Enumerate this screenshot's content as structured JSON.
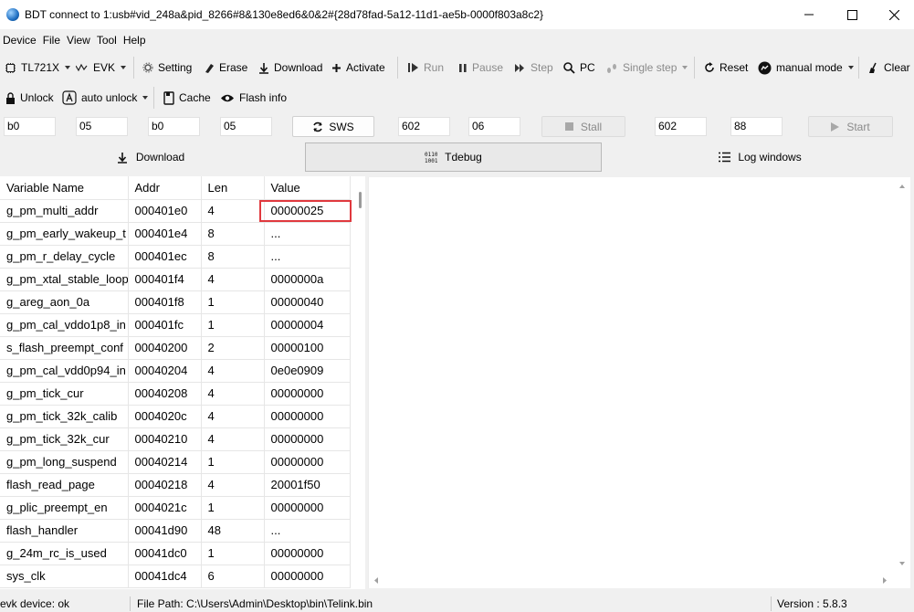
{
  "window": {
    "title": "BDT connect to 1:usb#vid_248a&pid_8266#8&130e8ed6&0&2#{28d78fad-5a12-11d1-ae5b-0000f803a8c2}"
  },
  "menu": [
    "Device",
    "File",
    "View",
    "Tool",
    "Help"
  ],
  "toolbar1": {
    "chip": "TL721X",
    "board": "EVK",
    "setting": "Setting",
    "erase": "Erase",
    "download": "Download",
    "activate": "Activate",
    "run": "Run",
    "pause": "Pause",
    "step": "Step",
    "pc": "PC",
    "single_step": "Single step",
    "reset": "Reset",
    "mode": "manual mode",
    "clear": "Clear"
  },
  "toolbar2": {
    "unlock": "Unlock",
    "auto_unlock": "auto unlock",
    "cache": "Cache",
    "flash_info": "Flash info"
  },
  "swire_row": {
    "f1": "b0",
    "f2": "05",
    "f3": "b0",
    "f4": "05",
    "sws_label": "SWS",
    "f5": "602",
    "f6": "06",
    "stall_label": "Stall",
    "f7": "602",
    "f8": "88",
    "start_label": "Start"
  },
  "tabs": {
    "download": "Download",
    "tdebug": "Tdebug",
    "log": "Log windows"
  },
  "table": {
    "headers": [
      "Variable Name",
      "Addr",
      "Len",
      "Value"
    ],
    "rows": [
      [
        "g_pm_multi_addr",
        "000401e0",
        "4",
        "00000025"
      ],
      [
        "g_pm_early_wakeup_t",
        "000401e4",
        "8",
        "..."
      ],
      [
        "g_pm_r_delay_cycle",
        "000401ec",
        "8",
        "..."
      ],
      [
        "g_pm_xtal_stable_loop",
        "000401f4",
        "4",
        "0000000a"
      ],
      [
        "g_areg_aon_0a",
        "000401f8",
        "1",
        "00000040"
      ],
      [
        "g_pm_cal_vddo1p8_in",
        "000401fc",
        "1",
        "00000004"
      ],
      [
        "s_flash_preempt_conf",
        "00040200",
        "2",
        "00000100"
      ],
      [
        "g_pm_cal_vdd0p94_in",
        "00040204",
        "4",
        "0e0e0909"
      ],
      [
        "g_pm_tick_cur",
        "00040208",
        "4",
        "00000000"
      ],
      [
        "g_pm_tick_32k_calib",
        "0004020c",
        "4",
        "00000000"
      ],
      [
        "g_pm_tick_32k_cur",
        "00040210",
        "4",
        "00000000"
      ],
      [
        "g_pm_long_suspend",
        "00040214",
        "1",
        "00000000"
      ],
      [
        "flash_read_page",
        "00040218",
        "4",
        "20001f50"
      ],
      [
        "g_plic_preempt_en",
        "0004021c",
        "1",
        "00000000"
      ],
      [
        "flash_handler",
        "00041d90",
        "48",
        "..."
      ],
      [
        "g_24m_rc_is_used",
        "00041dc0",
        "1",
        "00000000"
      ],
      [
        "sys_clk",
        "00041dc4",
        "6",
        "00000000"
      ]
    ]
  },
  "status": {
    "device": "evk device: ok",
    "file_path": "File Path:  C:\\Users\\Admin\\Desktop\\bin\\Telink.bin",
    "version": "Version : 5.8.3"
  },
  "colors": {
    "highlight": "#e0393e",
    "accent": "#1f6fc2"
  }
}
